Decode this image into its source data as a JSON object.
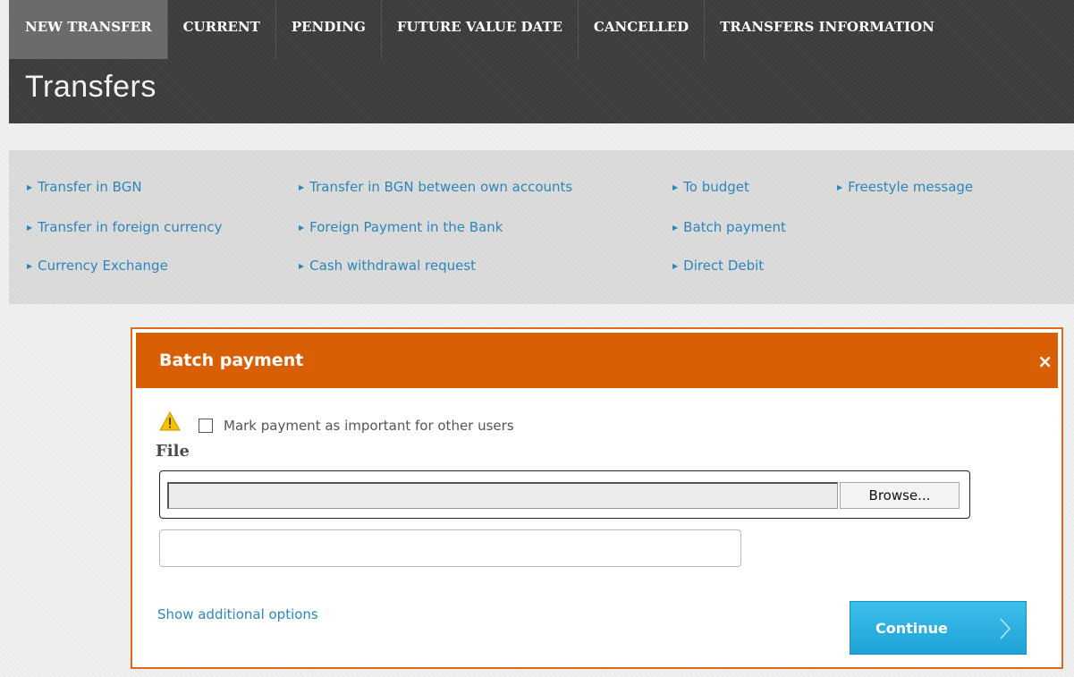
{
  "nav": {
    "tabs": [
      {
        "label": "NEW TRANSFER"
      },
      {
        "label": "CURRENT"
      },
      {
        "label": "PENDING"
      },
      {
        "label": "FUTURE VALUE DATE"
      },
      {
        "label": "CANCELLED"
      },
      {
        "label": "TRANSFERS INFORMATION"
      }
    ]
  },
  "page": {
    "title": "Transfers"
  },
  "quick_links": {
    "col1": [
      "Transfer in BGN",
      "Transfer in foreign currency",
      "Currency Exchange"
    ],
    "col2": [
      "Transfer in BGN between own accounts",
      "Foreign Payment in the Bank",
      "Cash withdrawal request"
    ],
    "col3": [
      "To budget",
      "Batch payment",
      "Direct Debit"
    ],
    "col4": [
      "Freestyle message"
    ]
  },
  "dialog": {
    "title": "Batch payment",
    "close_symbol": "×",
    "important_label": "Mark payment as important for other users",
    "file_label": "File",
    "browse_label": "Browse...",
    "file_path_value": "",
    "description_value": "",
    "more_options_label": "Show additional options",
    "continue_label": "Continue"
  },
  "colors": {
    "header_bg": "#3c3c3c",
    "active_tab": "#6b6b6b",
    "link": "#2e86b8",
    "dialog_header": "#d85f04",
    "dialog_border": "#e06a1a",
    "continue_button": "#1fa2d8"
  },
  "icons": {
    "warning": "warning-triangle-icon",
    "link_bullet": "caret-right-icon",
    "continue_arrow": "chevron-right-icon"
  }
}
